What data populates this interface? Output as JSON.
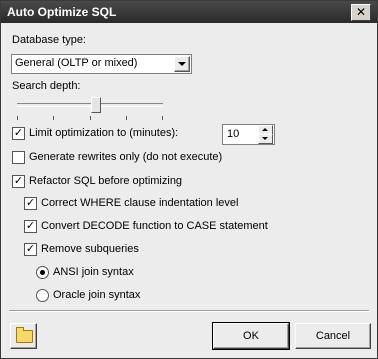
{
  "window": {
    "title": "Auto Optimize SQL",
    "close_label": "✕"
  },
  "database_type": {
    "label": "Database type:",
    "selected": "General (OLTP or mixed)"
  },
  "search_depth": {
    "label": "Search depth:",
    "level_ticks": 5,
    "value_fraction": 0.54
  },
  "limit": {
    "label": "Limit optimization to (minutes):",
    "checked": true,
    "value": "10"
  },
  "generate_rewrites": {
    "label": "Generate rewrites only (do not execute)",
    "checked": false
  },
  "refactor": {
    "label": "Refactor SQL before optimizing",
    "checked": true
  },
  "correct_where": {
    "label": "Correct WHERE clause indentation level",
    "checked": true
  },
  "convert_decode": {
    "label": "Convert DECODE function to CASE statement",
    "checked": true
  },
  "remove_subqueries": {
    "label": "Remove subqueries",
    "checked": true
  },
  "join_syntax": {
    "options": [
      {
        "label": "ANSI join syntax",
        "selected": true
      },
      {
        "label": "Oracle join syntax",
        "selected": false
      }
    ]
  },
  "buttons": {
    "ok": "OK",
    "cancel": "Cancel"
  },
  "icons": {
    "folder": "folder-open-icon"
  },
  "colors": {
    "titlebar": "#2a2a2a",
    "folder": "#f7d86b"
  }
}
